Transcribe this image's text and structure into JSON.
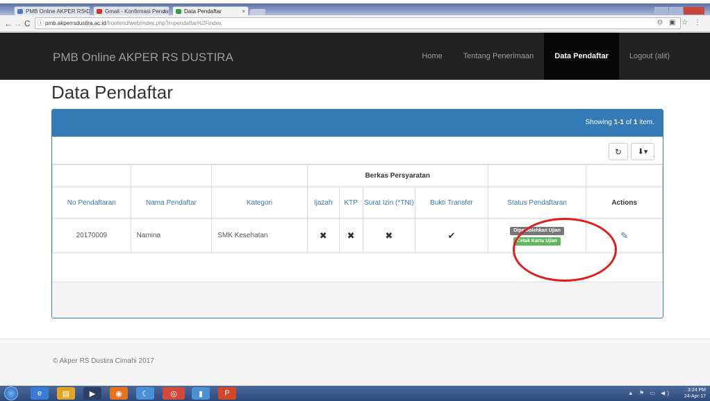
{
  "browser": {
    "tabs": [
      {
        "label": "PMB Online AKPER RS DUSTIRA",
        "fav_color": "#4a7bd0"
      },
      {
        "label": "Gmail - Konfirmasi Pendaftaran",
        "fav_color": "#d93025"
      },
      {
        "label": "Data Pendaftar",
        "fav_color": "#2ea043"
      }
    ],
    "url_host": "pmb.akperrsdustira.ac.id",
    "url_path": "/frontend/web/index.php?r=pendaftar%2Findex",
    "nav_back": "←",
    "nav_forward": "→",
    "nav_reload": "C",
    "extensions": "⊙ ▣ ☆ ⋮"
  },
  "navbar": {
    "brand": "PMB Online AKPER RS DUSTIRA",
    "links": [
      "Home",
      "Tentang Penerimaan",
      "Data Pendaftar",
      "Logout (alit)"
    ]
  },
  "page": {
    "title": "Data Pendaftar"
  },
  "grid": {
    "summary_prefix": "Showing ",
    "summary_range": "1-1",
    "summary_mid": " of ",
    "summary_total": "1",
    "summary_suffix": " item.",
    "refresh_icon": "↻",
    "export_icon": "⬇▾",
    "group_header": "Berkas Persyaratan",
    "columns": [
      "No Pendaftaran",
      "Nama Pendaftar",
      "Kategori",
      "Ijazah",
      "KTP",
      "Surat Izin (*TNI)",
      "Bukti Transfer",
      "Status Pendaftaran",
      "Actions"
    ],
    "rows": [
      {
        "no": "20170009",
        "nama": "Namina",
        "kategori": "SMK Kesehatan",
        "ijazah": "✖",
        "ktp": "✖",
        "surat_izin": "✖",
        "bukti_transfer": "✔",
        "status_1": "Diperbolehkan Ujian",
        "status_2": "Cetak Kartu Ujian",
        "action_icon": "✎"
      }
    ]
  },
  "footer": {
    "copyright": "© Akper RS Dustira Cimahi 2017"
  },
  "taskbar": {
    "apps": [
      {
        "icon": "e",
        "color": "#3a7bd5"
      },
      {
        "icon": "▤",
        "color": "#e0a526"
      },
      {
        "icon": "▶",
        "color": "#2a3f63"
      },
      {
        "icon": "◉",
        "color": "#e8711c"
      },
      {
        "icon": "☾",
        "color": "#4b8fd6"
      },
      {
        "icon": "◎",
        "color": "#d44a3a"
      },
      {
        "icon": "▮",
        "color": "#4b8fd6"
      },
      {
        "icon": "P",
        "color": "#d24726"
      }
    ],
    "tray_icons": "▲ ⚑ ▭ ◀)",
    "time": "3:24 PM",
    "date": "24-Apr-17"
  },
  "colors": {
    "primary": "#337ab7",
    "navbar": "#222222",
    "annotation": "#e21b1b",
    "badge_grey": "#777777",
    "badge_green": "#5cb85c"
  }
}
